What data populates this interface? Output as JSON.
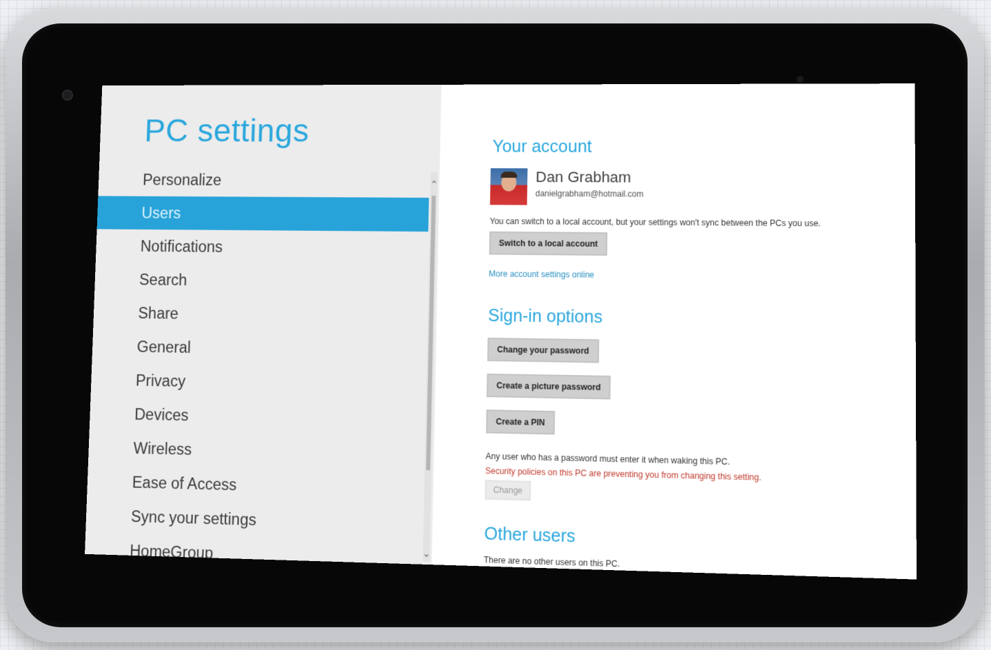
{
  "sidebar": {
    "title": "PC settings",
    "items": [
      {
        "label": "Personalize"
      },
      {
        "label": "Users",
        "selected": true
      },
      {
        "label": "Notifications"
      },
      {
        "label": "Search"
      },
      {
        "label": "Share"
      },
      {
        "label": "General"
      },
      {
        "label": "Privacy"
      },
      {
        "label": "Devices"
      },
      {
        "label": "Wireless"
      },
      {
        "label": "Ease of Access"
      },
      {
        "label": "Sync your settings"
      },
      {
        "label": "HomeGroup"
      }
    ]
  },
  "your_account": {
    "heading": "Your account",
    "name": "Dan Grabham",
    "email": "danielgrabham@hotmail.com",
    "local_note": "You can switch to a local account, but your settings won't sync between the PCs you use.",
    "switch_button": "Switch to a local account",
    "more_link": "More account settings online"
  },
  "signin": {
    "heading": "Sign-in options",
    "change_password_button": "Change your password",
    "picture_password_button": "Create a picture password",
    "pin_button": "Create a PIN",
    "wake_note": "Any user who has a password must enter it when waking this PC.",
    "policy_warning": "Security policies on this PC are preventing you from changing this setting.",
    "change_button": "Change"
  },
  "other_users": {
    "heading": "Other users",
    "note": "There are no other users on this PC."
  },
  "colors": {
    "accent": "#2aa7dd",
    "selected_bg": "#28a3d9",
    "warning": "#c0392b"
  }
}
